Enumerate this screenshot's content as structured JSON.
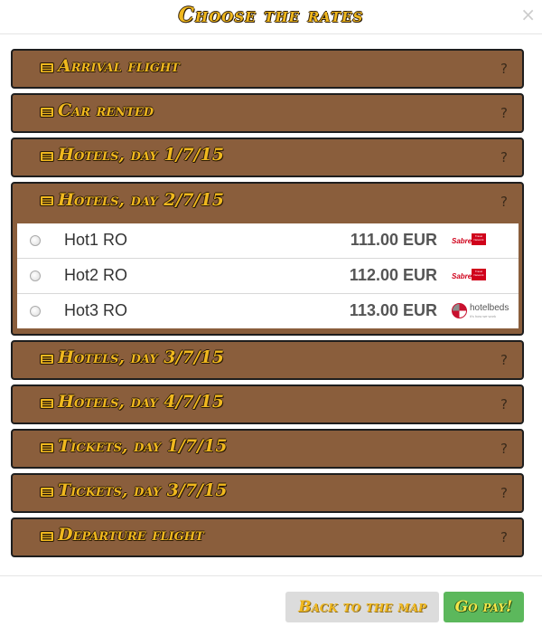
{
  "modal": {
    "title": "Choose the rates",
    "close_glyph": "×"
  },
  "panels": [
    {
      "title": "Arrival flight",
      "help": "?",
      "icon": "list-icon",
      "expanded": false
    },
    {
      "title": "Car rented",
      "help": "?",
      "icon": "list-icon",
      "expanded": false
    },
    {
      "title": "Hotels, day 1/7/15",
      "help": "?",
      "icon": "list-icon",
      "expanded": false
    },
    {
      "title": "Hotels, day 2/7/15",
      "help": "?",
      "icon": "list-icon",
      "expanded": true
    },
    {
      "title": "Hotels, day 3/7/15",
      "help": "?",
      "icon": "list-icon",
      "expanded": false
    },
    {
      "title": "Hotels, day 4/7/15",
      "help": "?",
      "icon": "list-icon",
      "expanded": false
    },
    {
      "title": "Tickets, day 1/7/15",
      "help": "?",
      "icon": "list-icon",
      "expanded": false
    },
    {
      "title": "Tickets, day 3/7/15",
      "help": "?",
      "icon": "list-icon",
      "expanded": false
    },
    {
      "title": "Departure flight",
      "help": "?",
      "icon": "list-icon",
      "expanded": false
    }
  ],
  "rates": [
    {
      "name": "Hot1 RO",
      "price": "111.00 EUR",
      "provider_logo": "sabre-logo",
      "selected": false
    },
    {
      "name": "Hot2 RO",
      "price": "112.00 EUR",
      "provider_logo": "sabre-logo",
      "selected": false
    },
    {
      "name": "Hot3 RO",
      "price": "113.00 EUR",
      "provider_logo": "hotelbeds-logo",
      "selected": false
    }
  ],
  "logos": {
    "sabre_word": "Sabre",
    "sabre_box": "Travel Network",
    "hotelbeds_word": "hotelbeds",
    "hotelbeds_tag": "it's how we work"
  },
  "footer": {
    "back_label": "Back to the map",
    "go_label": "Go pay!"
  },
  "colors": {
    "panel_bg": "#8a5e3c",
    "title_gold": "#f0b81e",
    "go_green": "#5cb85c",
    "back_gray": "#dcdcdc"
  }
}
